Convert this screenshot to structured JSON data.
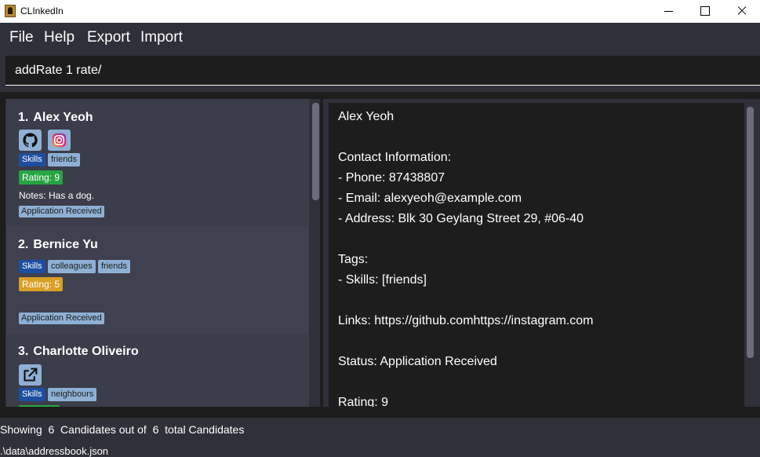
{
  "window": {
    "title": "CLInkedIn"
  },
  "menu": [
    "File",
    "Help",
    "Export",
    "Import"
  ],
  "command": {
    "value": "addRate 1 rate/"
  },
  "cards": [
    {
      "index": "1.",
      "name": "Alex Yeoh",
      "socials": [
        "github-icon",
        "instagram-icon"
      ],
      "tags": [
        "Skills",
        "friends"
      ],
      "rating": "Rating: 9",
      "notes": "Notes: Has a dog.",
      "status": "Application Received"
    },
    {
      "index": "2.",
      "name": "Bernice Yu",
      "tags": [
        "Skills",
        "colleagues",
        "friends"
      ],
      "rating": "Rating: 5",
      "status": "Application Received"
    },
    {
      "index": "3.",
      "name": "Charlotte Oliveiro",
      "socials": [
        "external-link-icon"
      ],
      "tags": [
        "Skills",
        "neighbours"
      ]
    }
  ],
  "detail": {
    "lines": [
      "Alex Yeoh",
      "Contact Information:",
      "- Phone: 87438807",
      "- Email: alexyeoh@example.com",
      "- Address: Blk 30 Geylang Street 29, #06-40",
      "Tags:",
      "- Skills: [friends]",
      "Links: https://github.comhttps://instagram.com",
      "Status: Application Received",
      "Rating: 9"
    ]
  },
  "status_bar": {
    "text": "Showing  6  Candidates out of  6  total Candidates"
  },
  "footer": {
    "path": ".\\data\\addressbook.json"
  },
  "colors": {
    "background": "#1d1d1d",
    "panel": "#2f3039",
    "card": "#3b3d4a",
    "tag_skills": "#1d4ea0",
    "tag_light": "#8fb0d4",
    "rating_high": "#27a543",
    "rating_mid": "#d8a024"
  }
}
